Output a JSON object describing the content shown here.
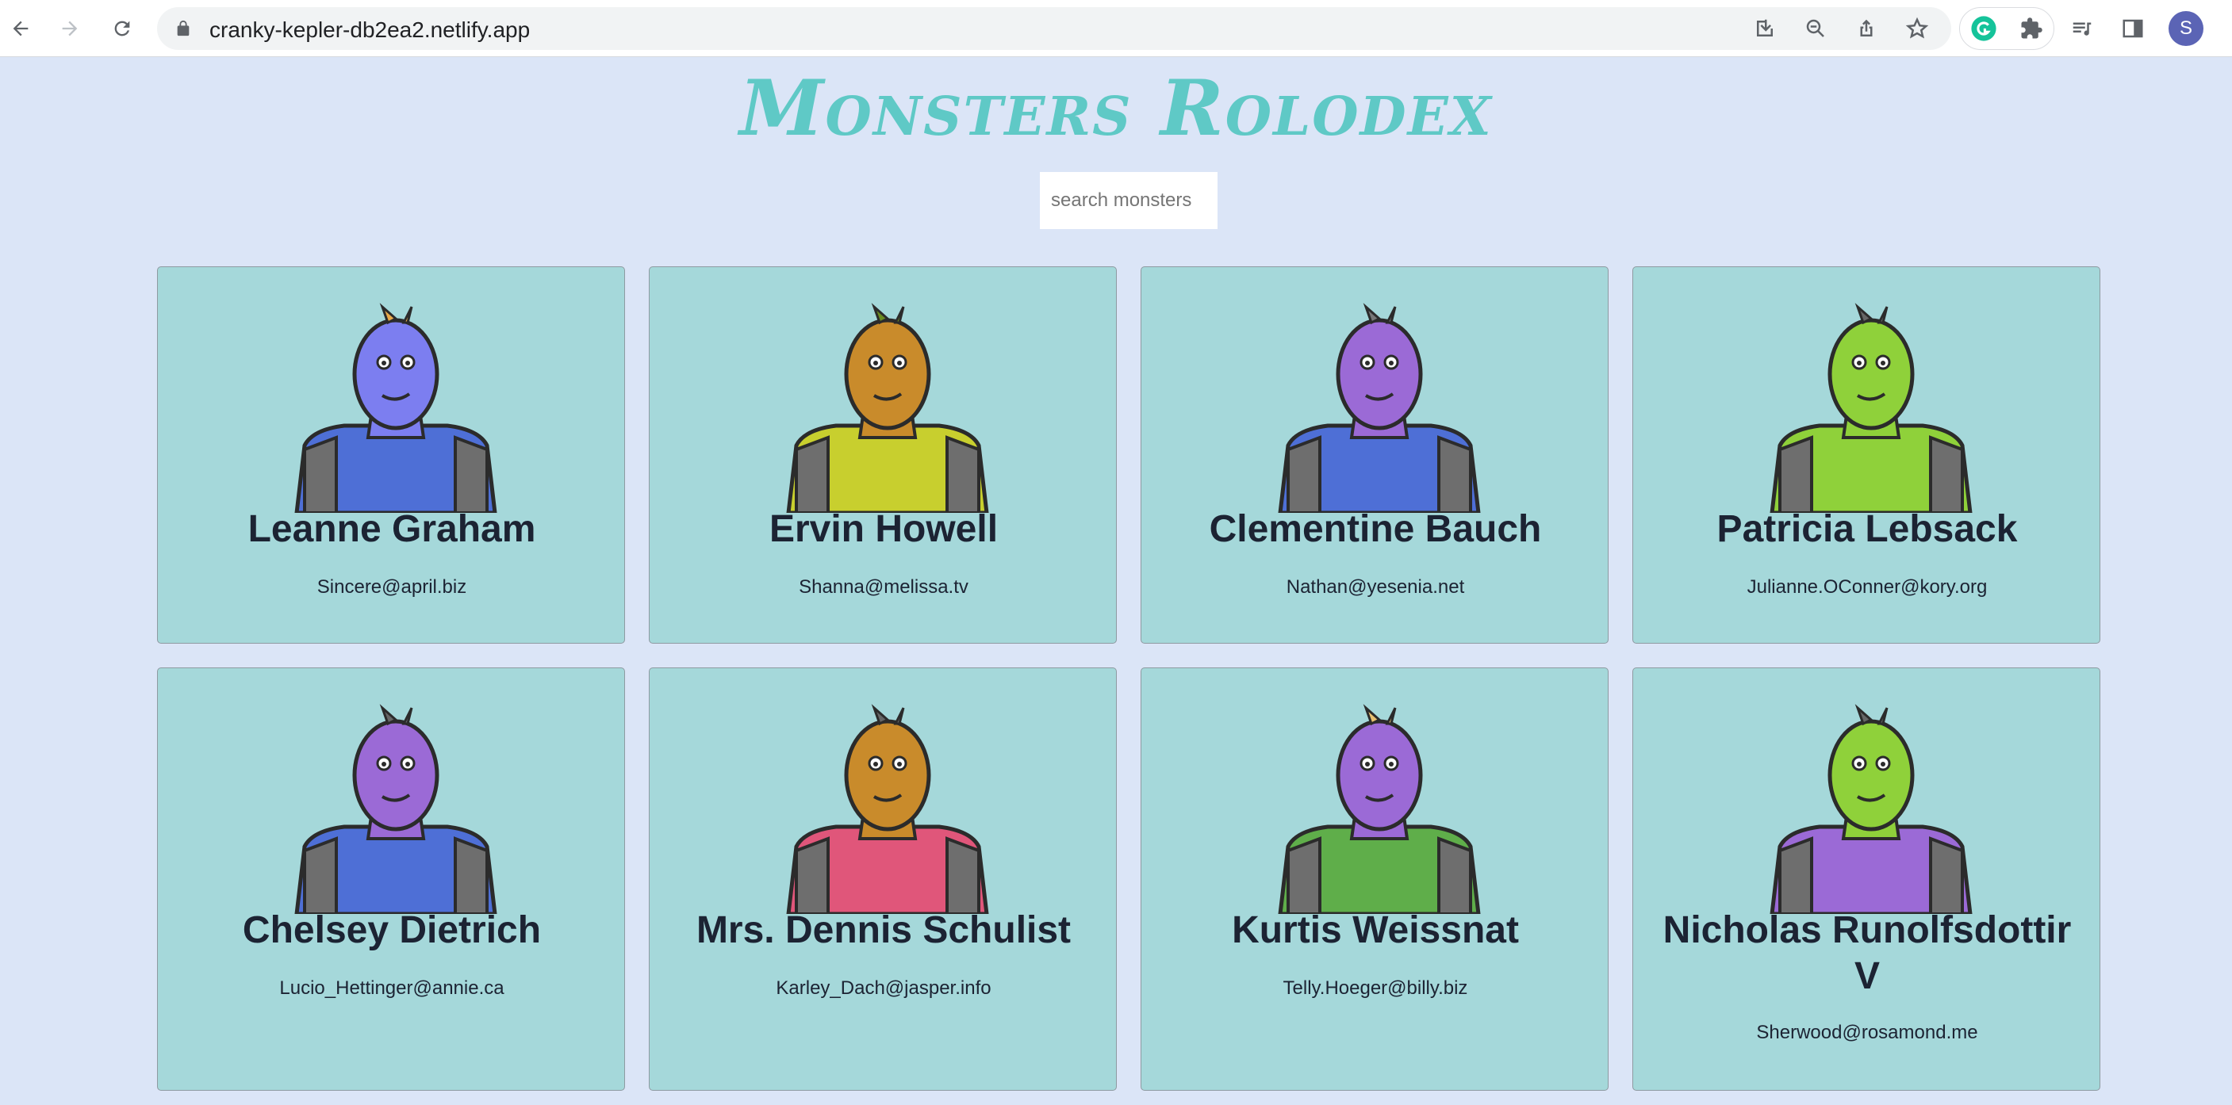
{
  "browser": {
    "url": "cranky-kepler-db2ea2.netlify.app",
    "profile_initial": "S"
  },
  "page": {
    "title": "Monsters Rolodex",
    "search_placeholder": "search monsters"
  },
  "monsters": [
    {
      "name": "Leanne Graham",
      "email": "Sincere@april.biz",
      "skin": "#7c7ef0",
      "body": "#4e6fd6",
      "accent": "#e8a94a"
    },
    {
      "name": "Ervin Howell",
      "email": "Shanna@melissa.tv",
      "skin": "#c98b2b",
      "body": "#c8cf2e",
      "accent": "#6a8a1f"
    },
    {
      "name": "Clementine Bauch",
      "email": "Nathan@yesenia.net",
      "skin": "#9b6ad6",
      "body": "#4e6fd6",
      "accent": "#777"
    },
    {
      "name": "Patricia Lebsack",
      "email": "Julianne.OConner@kory.org",
      "skin": "#8fd13a",
      "body": "#8fd13a",
      "accent": "#666"
    },
    {
      "name": "Chelsey Dietrich",
      "email": "Lucio_Hettinger@annie.ca",
      "skin": "#9b6ad6",
      "body": "#4e6fd6",
      "accent": "#666"
    },
    {
      "name": "Mrs. Dennis Schulist",
      "email": "Karley_Dach@jasper.info",
      "skin": "#c98b2b",
      "body": "#e0567a",
      "accent": "#666"
    },
    {
      "name": "Kurtis Weissnat",
      "email": "Telly.Hoeger@billy.biz",
      "skin": "#9b6ad6",
      "body": "#5fae4a",
      "accent": "#e8c070"
    },
    {
      "name": "Nicholas Runolfsdottir V",
      "email": "Sherwood@rosamond.me",
      "skin": "#8fd13a",
      "body": "#9b6ad6",
      "accent": "#666"
    }
  ]
}
